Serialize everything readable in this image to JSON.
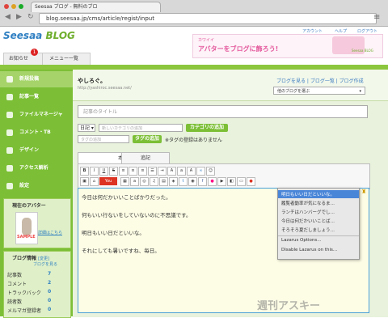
{
  "browser": {
    "tab_title": "Seesaa ブログ - 無料のブロ",
    "url": "blog.seesaa.jp/cms/article/regist/input",
    "back": "◀",
    "forward": "▶",
    "reload": "↻"
  },
  "header": {
    "logo_seesaa": "Seesaa",
    "logo_blog": "BLOG",
    "top_links": [
      "アカウント",
      "ヘルプ",
      "ログアウト"
    ],
    "banner_text_small": "カワイイ",
    "banner_text": "アバターをブログに飾ろう!",
    "banner_logo": "Seesaa BLOG",
    "notice_tab": "お知らせ",
    "notice_count": "1",
    "menu_tab": "メニュー一覧"
  },
  "sidebar": {
    "items": [
      {
        "label": "新規投稿"
      },
      {
        "label": "記事一覧"
      },
      {
        "label": "ファイルマネージャ"
      },
      {
        "label": "コメント・TB"
      },
      {
        "label": "デザイン"
      },
      {
        "label": "アクセス解析"
      },
      {
        "label": "設定"
      }
    ],
    "avatar_title": "現在のアバター",
    "avatar_sample": "SAMPLE",
    "avatar_link": "詳細はこちら",
    "info_title": "ブログ情報",
    "info_edit": "[変更]",
    "info_view": "ブログを見る",
    "stats": [
      {
        "label": "記事数",
        "value": "7"
      },
      {
        "label": "コメント",
        "value": "2"
      },
      {
        "label": "トラックバック",
        "value": "0"
      },
      {
        "label": "読者数",
        "value": "0"
      },
      {
        "label": "メルマガ登録者",
        "value": "0"
      }
    ]
  },
  "main": {
    "blog_name": "やしろぐ。",
    "blog_url": "http://yashiroc.seesaa.net/",
    "links": "ブログを見る | ブログ一覧 | ブログ作成",
    "other_blog": "他のブログを選ぶ",
    "title_placeholder": "記事のタイトル",
    "date_select": "日記",
    "category_placeholder": "新しいカテゴリの追加",
    "category_add": "カテゴリの追加",
    "tag_placeholder": "タグの追加",
    "tag_add": "タグの追加",
    "tag_note": "※タグの登録はありません",
    "tab_body": "本文",
    "tab_add": "追記",
    "body_lines": [
      "今日は何だかいいことばかりだった。",
      "何もいい行ないをしていないのに不思議です。",
      "明日もいい日だといいな。",
      "それにしても暑いですね、毎日。"
    ]
  },
  "context_menu": {
    "items": [
      "明日もいい日だといいな。",
      "履覧者動率が気になるま…",
      "ランチはハンバーグでし…",
      "今日は何だかいいことば…",
      "そろそろ夏だしましょう…",
      "Lazarus Options...",
      "Disable Lazarus on this..."
    ]
  },
  "watermark": "週刊アスキー"
}
